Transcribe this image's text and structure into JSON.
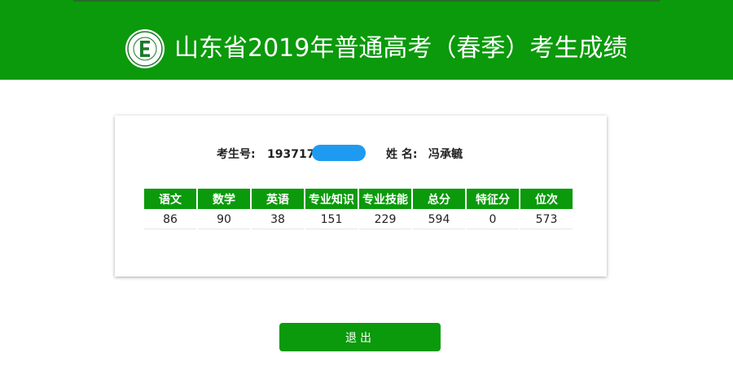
{
  "header": {
    "title": "山东省2019年普通高考（春季）考生成绩",
    "logo_icon": "exam-authority-seal-icon",
    "bg_color": "#0b9a0b"
  },
  "student": {
    "exam_no_label": "考生号:",
    "exam_no_value": "193717",
    "exam_no_masked": true,
    "name_label": "姓 名:",
    "name_value": "冯承毓"
  },
  "scores": {
    "headers": [
      "语文",
      "数学",
      "英语",
      "专业知识",
      "专业技能",
      "总分",
      "特征分",
      "位次"
    ],
    "values": [
      "86",
      "90",
      "38",
      "151",
      "229",
      "594",
      "0",
      "573"
    ]
  },
  "actions": {
    "logout_label": "退出"
  }
}
